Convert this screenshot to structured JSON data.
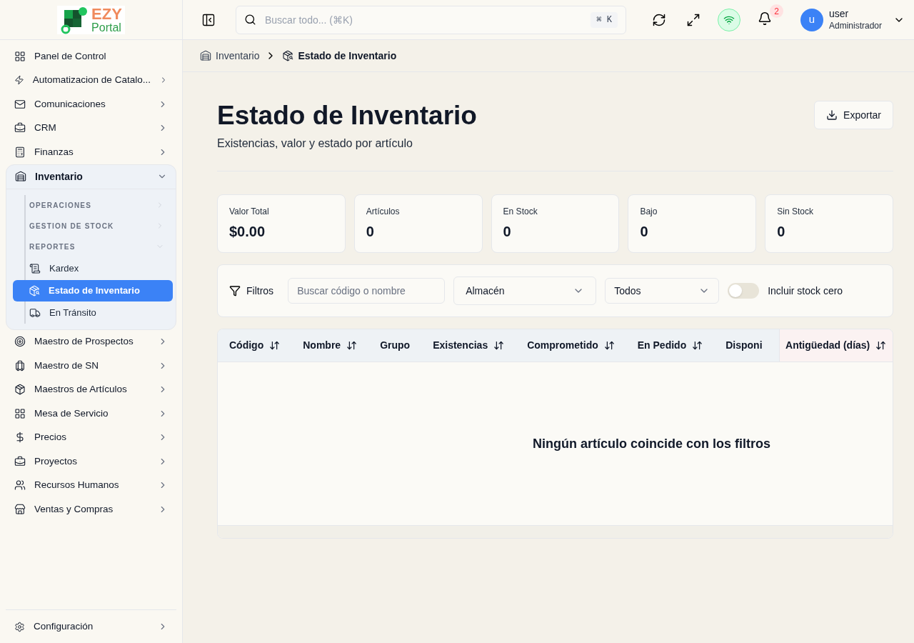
{
  "logo": {
    "line_1": "EZY",
    "line_2": "Portal"
  },
  "sidebar": {
    "items": [
      {
        "label": "Panel de Control",
        "kind": "link"
      },
      {
        "label": "Automatizacion de Catalo...",
        "kind": "group",
        "expanded": false
      },
      {
        "label": "Comunicaciones",
        "kind": "group",
        "expanded": false
      },
      {
        "label": "CRM",
        "kind": "group",
        "expanded": false
      },
      {
        "label": "Finanzas",
        "kind": "group",
        "expanded": false
      },
      {
        "label": "Inventario",
        "kind": "group",
        "expanded": true,
        "children": [
          {
            "label": "OPERACIONES",
            "kind": "section",
            "expanded": false
          },
          {
            "label": "GESTION DE STOCK",
            "kind": "section",
            "expanded": false
          },
          {
            "label": "REPORTES",
            "kind": "section",
            "expanded": true,
            "children": [
              {
                "label": "Kardex",
                "selected": false
              },
              {
                "label": "Estado de Inventario",
                "selected": true
              },
              {
                "label": "En Tránsito",
                "selected": false
              }
            ]
          }
        ]
      },
      {
        "label": "Maestro de Prospectos",
        "kind": "group",
        "expanded": false
      },
      {
        "label": "Maestro de SN",
        "kind": "group",
        "expanded": false
      },
      {
        "label": "Maestros de Artículos",
        "kind": "group",
        "expanded": false
      },
      {
        "label": "Mesa de Servicio",
        "kind": "group",
        "expanded": false
      },
      {
        "label": "Precios",
        "kind": "group",
        "expanded": false
      },
      {
        "label": "Proyectos",
        "kind": "group",
        "expanded": false
      },
      {
        "label": "Recursos Humanos",
        "kind": "group",
        "expanded": false
      },
      {
        "label": "Ventas y Compras",
        "kind": "group",
        "expanded": false
      }
    ],
    "footer_item": {
      "label": "Configuración",
      "expanded": false
    }
  },
  "topbar": {
    "search": {
      "placeholder": "Buscar todo... (⌘K)",
      "shortcut": "⌘ K"
    },
    "connection_online": true,
    "notifications": "2",
    "user": {
      "initial": "u",
      "name": "user",
      "role": "Administrador"
    }
  },
  "breadcrumb": [
    {
      "label": "Inventario",
      "current": false
    },
    {
      "label": "Estado de Inventario",
      "current": true
    }
  ],
  "page": {
    "title": "Estado de Inventario",
    "subtitle": "Existencias, valor y estado por artículo",
    "export_button": "Exportar"
  },
  "stats": [
    {
      "label": "Valor Total",
      "value": "$0.00"
    },
    {
      "label": "Artículos",
      "value": "0"
    },
    {
      "label": "En Stock",
      "value": "0"
    },
    {
      "label": "Bajo",
      "value": "0"
    },
    {
      "label": "Sin Stock",
      "value": "0"
    }
  ],
  "filters": {
    "label": "Filtros",
    "search": {
      "placeholder": "Buscar código o nombre"
    },
    "warehouse": "Almacén",
    "status": "Todos",
    "include_zero": {
      "label": "Incluir stock cero",
      "on": false
    }
  },
  "table": {
    "columns": [
      {
        "label": "Código",
        "sortable": true,
        "pinned": false
      },
      {
        "label": "Nombre",
        "sortable": true,
        "pinned": false
      },
      {
        "label": "Grupo",
        "sortable": false,
        "pinned": false
      },
      {
        "label": "Existencias",
        "sortable": true,
        "pinned": false
      },
      {
        "label": "Comprometido",
        "sortable": true,
        "pinned": false
      },
      {
        "label": "En Pedido",
        "sortable": true,
        "pinned": false
      },
      {
        "label": "Disponi",
        "sortable": false,
        "pinned": false
      },
      {
        "label": "Antigüedad (días)",
        "sortable": true,
        "pinned": true
      }
    ],
    "empty_message": "Ningún artículo coincide con los filtros"
  }
}
